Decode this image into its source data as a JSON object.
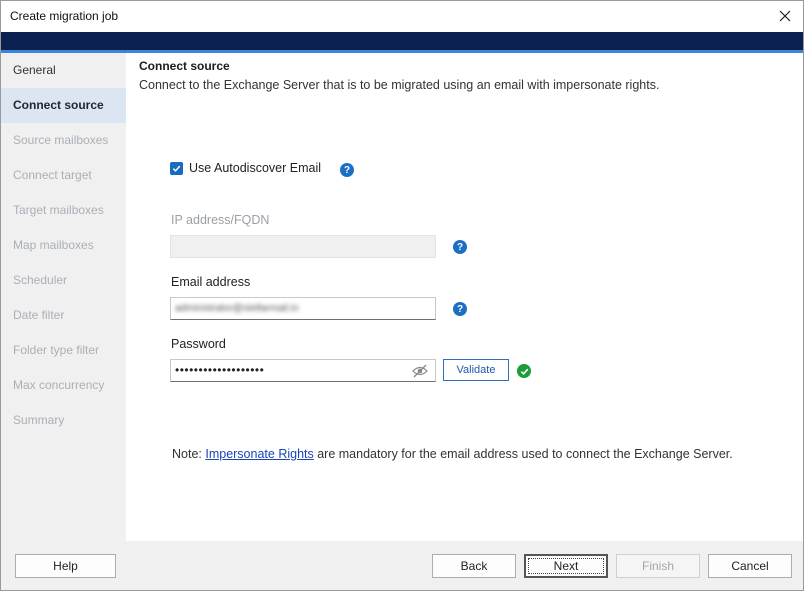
{
  "window": {
    "title": "Create migration job"
  },
  "colors": {
    "header_band": "#0b2152",
    "accent": "#1d6fc4",
    "active_nav_bg": "#dce6f3",
    "success": "#1e9c3a"
  },
  "sidebar": {
    "items": [
      {
        "label": "General",
        "state": "done"
      },
      {
        "label": "Connect source",
        "state": "active"
      },
      {
        "label": "Source mailboxes",
        "state": "pending"
      },
      {
        "label": "Connect target",
        "state": "pending"
      },
      {
        "label": "Target mailboxes",
        "state": "pending"
      },
      {
        "label": "Map mailboxes",
        "state": "pending"
      },
      {
        "label": "Scheduler",
        "state": "pending"
      },
      {
        "label": "Date filter",
        "state": "pending"
      },
      {
        "label": "Folder type filter",
        "state": "pending"
      },
      {
        "label": "Max concurrency",
        "state": "pending"
      },
      {
        "label": "Summary",
        "state": "pending"
      }
    ]
  },
  "page": {
    "title": "Connect source",
    "description": "Connect to the Exchange Server that is to be migrated using an email with impersonate rights."
  },
  "form": {
    "autodiscover": {
      "label": "Use Autodiscover Email",
      "checked": true,
      "help_icon": "question-circle-icon"
    },
    "ip": {
      "label": "IP address/FQDN",
      "value": "",
      "disabled": true
    },
    "email": {
      "label": "Email address",
      "value": "administrator@stellarmail.in"
    },
    "password": {
      "label": "Password",
      "value": "•••••••••••••••••••",
      "toggle_icon": "eye-slash-icon"
    },
    "validate_label": "Validate",
    "validated_icon": "check-circle-icon"
  },
  "note": {
    "prefix": "Note: ",
    "link": "Impersonate Rights",
    "suffix": " are mandatory for the email address used to connect the Exchange Server."
  },
  "footer": {
    "help": "Help",
    "back": "Back",
    "next": "Next",
    "finish": "Finish",
    "cancel": "Cancel"
  }
}
